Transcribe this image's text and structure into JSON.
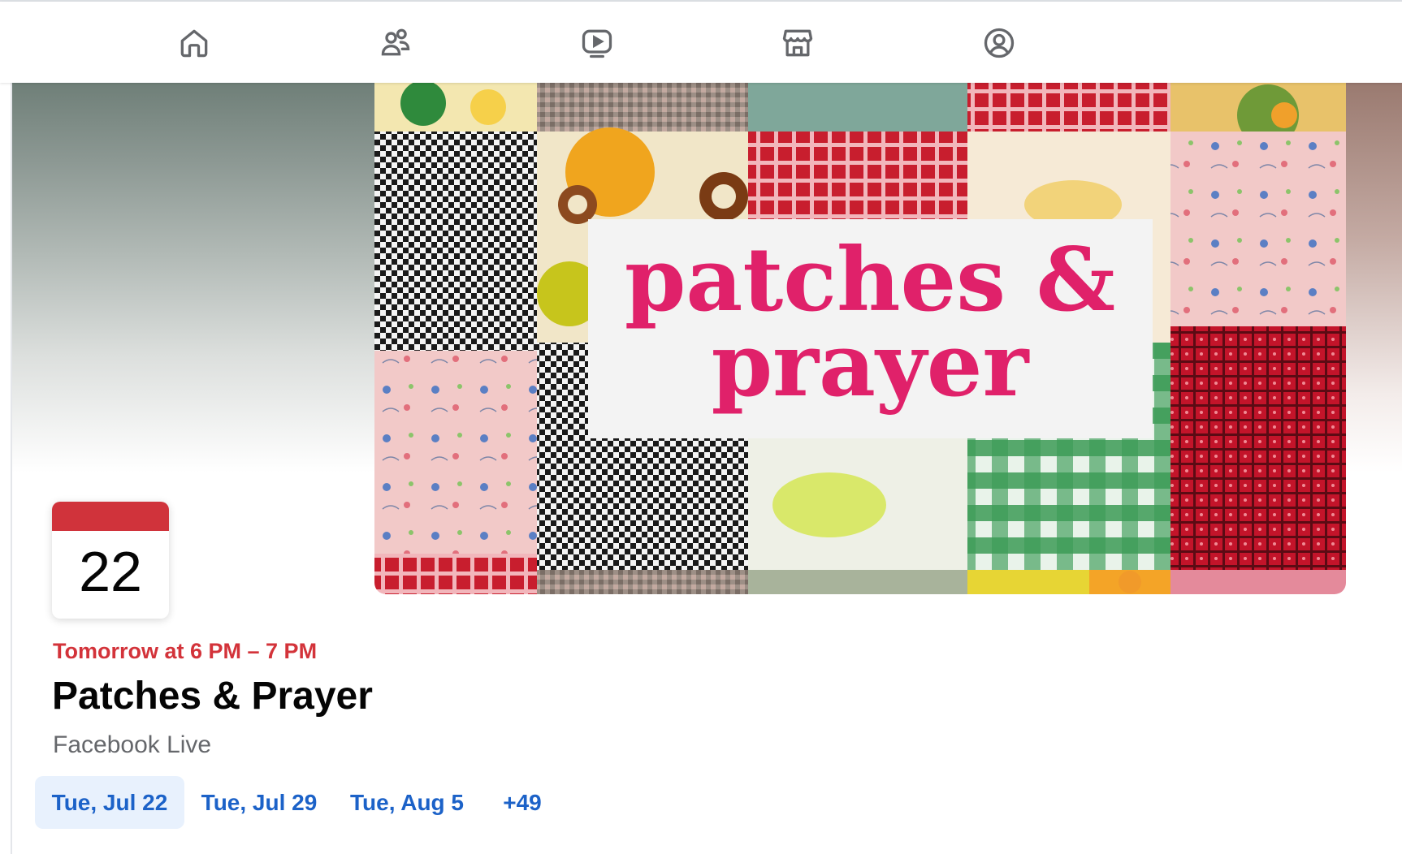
{
  "navbar": {
    "items": [
      {
        "name": "home-icon"
      },
      {
        "name": "friends-icon"
      },
      {
        "name": "video-icon"
      },
      {
        "name": "marketplace-icon"
      },
      {
        "name": "profile-icon"
      }
    ]
  },
  "cover": {
    "text_line1": "patches &",
    "text_line2": "prayer",
    "text_color": "#e0216a"
  },
  "event": {
    "calendar_day": "22",
    "time": "Tomorrow at 6 PM – 7 PM",
    "title": "Patches & Prayer",
    "location": "Facebook Live",
    "dates": [
      {
        "label": "Tue, Jul 22",
        "selected": true
      },
      {
        "label": "Tue, Jul 29",
        "selected": false
      },
      {
        "label": "Tue, Aug 5",
        "selected": false
      },
      {
        "label": "+49",
        "selected": false
      }
    ]
  },
  "colors": {
    "accent_red": "#d3333a",
    "link_blue": "#1c62c8",
    "selected_bg": "#e8f1fd"
  }
}
